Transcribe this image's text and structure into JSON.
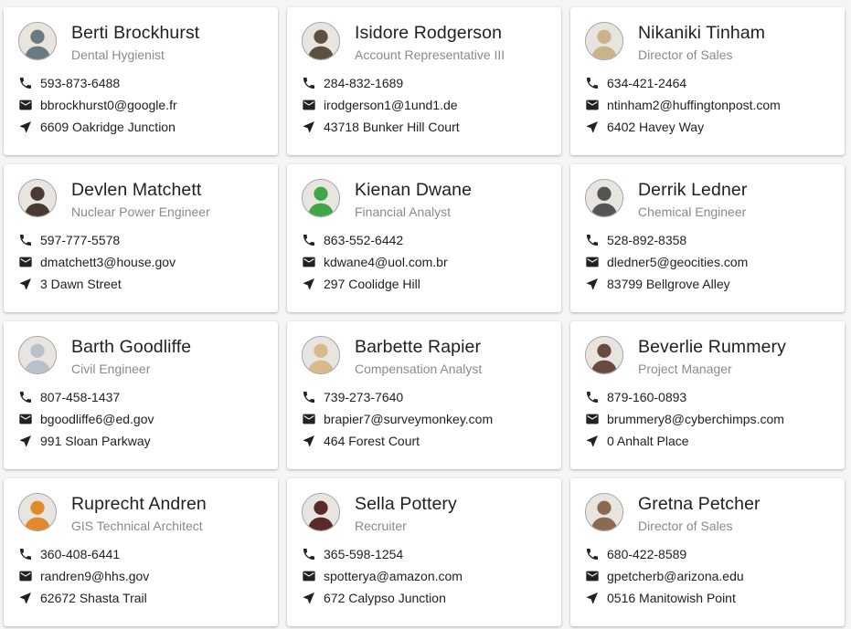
{
  "icons": {
    "phone": "phone-icon",
    "email": "email-icon",
    "address": "navigation-arrow-icon"
  },
  "colors": {
    "text": "#212121",
    "subtitle": "#8a8a8a",
    "card": "#ffffff",
    "background": "#f5f5f5"
  },
  "contacts": [
    {
      "name": "Berti Brockhurst",
      "title": "Dental Hygienist",
      "phone": "593-873-6488",
      "email": "bbrockhurst0@google.fr",
      "address": "6609 Oakridge Junction",
      "avatar_color": "#6b7a80"
    },
    {
      "name": "Isidore Rodgerson",
      "title": "Account Representative III",
      "phone": "284-832-1689",
      "email": "irodgerson1@1und1.de",
      "address": "43718 Bunker Hill Court",
      "avatar_color": "#5c5040"
    },
    {
      "name": "Nikaniki Tinham",
      "title": "Director of Sales",
      "phone": "634-421-2464",
      "email": "ntinham2@huffingtonpost.com",
      "address": "6402 Havey Way",
      "avatar_color": "#c9b48a"
    },
    {
      "name": "Devlen Matchett",
      "title": "Nuclear Power Engineer",
      "phone": "597-777-5578",
      "email": "dmatchett3@house.gov",
      "address": "3 Dawn Street",
      "avatar_color": "#4a3a32"
    },
    {
      "name": "Kienan Dwane",
      "title": "Financial Analyst",
      "phone": "863-552-6442",
      "email": "kdwane4@uol.com.br",
      "address": "297 Coolidge Hill",
      "avatar_color": "#3fa64a"
    },
    {
      "name": "Derrik Ledner",
      "title": "Chemical Engineer",
      "phone": "528-892-8358",
      "email": "dledner5@geocities.com",
      "address": "83799 Bellgrove Alley",
      "avatar_color": "#555555"
    },
    {
      "name": "Barth Goodliffe",
      "title": "Civil Engineer",
      "phone": "807-458-1437",
      "email": "bgoodliffe6@ed.gov",
      "address": "991 Sloan Parkway",
      "avatar_color": "#b8c0cc"
    },
    {
      "name": "Barbette Rapier",
      "title": "Compensation Analyst",
      "phone": "739-273-7640",
      "email": "brapier7@surveymonkey.com",
      "address": "464 Forest Court",
      "avatar_color": "#d8b98a"
    },
    {
      "name": "Beverlie Rummery",
      "title": "Project Manager",
      "phone": "879-160-0893",
      "email": "brummery8@cyberchimps.com",
      "address": "0 Anhalt Place",
      "avatar_color": "#6a4a3e"
    },
    {
      "name": "Ruprecht Andren",
      "title": "GIS Technical Architect",
      "phone": "360-408-6441",
      "email": "randren9@hhs.gov",
      "address": "62672 Shasta Trail",
      "avatar_color": "#e08a2a"
    },
    {
      "name": "Sella Pottery",
      "title": "Recruiter",
      "phone": "365-598-1254",
      "email": "spotterya@amazon.com",
      "address": "672 Calypso Junction",
      "avatar_color": "#5a2a2a"
    },
    {
      "name": "Gretna Petcher",
      "title": "Director of Sales",
      "phone": "680-422-8589",
      "email": "gpetcherb@arizona.edu",
      "address": "0516 Manitowish Point",
      "avatar_color": "#8a6a50"
    }
  ]
}
